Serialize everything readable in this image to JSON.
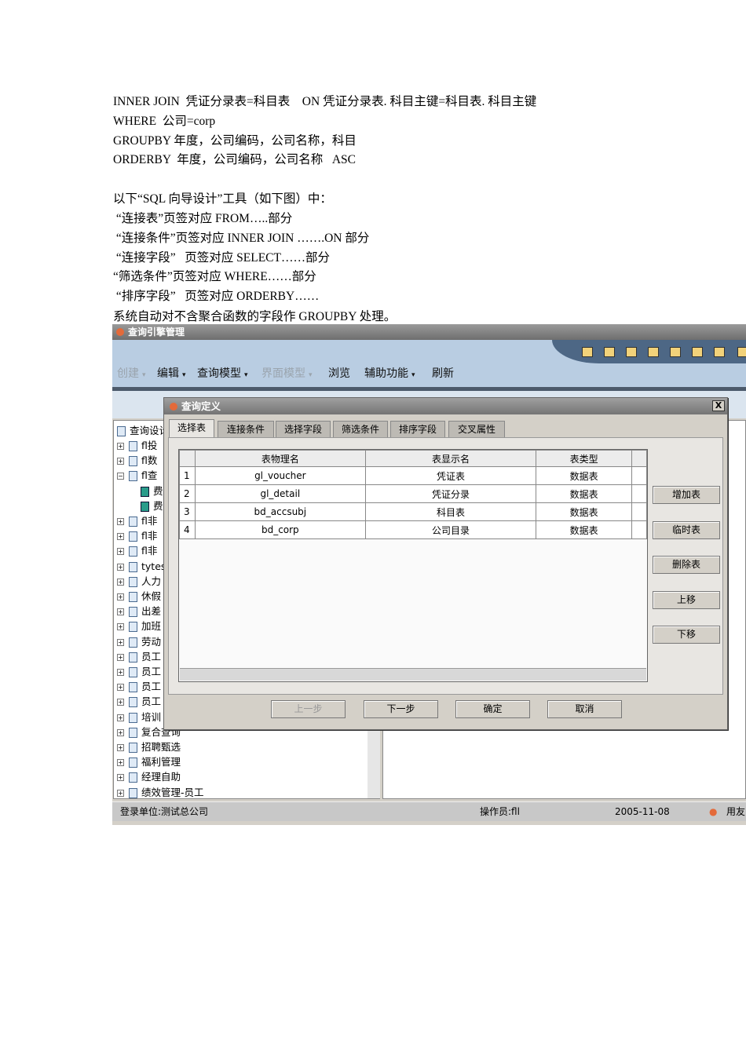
{
  "doc_lines": [
    "INNER JOIN  凭证分录表=科目表    ON 凭证分录表. 科目主键=科目表. 科目主键",
    "WHERE  公司=corp",
    "GROUPBY 年度，公司编码，公司名称，科目",
    "ORDERBY  年度，公司编码，公司名称   ASC",
    "以下“SQL 向导设计”工具（如下图）中：",
    " “连接表”页签对应 FROM…..部分",
    " “连接条件”页签对应 INNER JOIN …….ON 部分",
    " “连接字段”   页签对应 SELECT……部分",
    "“筛选条件”页签对应 WHERE……部分",
    " “排序字段”   页签对应 ORDERBY……",
    "系统自动对不含聚合函数的字段作 GROUPBY 处理。"
  ],
  "app": {
    "title": "查询引擎管理",
    "menu": [
      {
        "label": "创建",
        "disabled": true
      },
      {
        "label": "编辑"
      },
      {
        "label": "查询模型"
      },
      {
        "label": "界面模型",
        "disabled": true
      },
      {
        "label": "浏览"
      },
      {
        "label": "辅助功能"
      },
      {
        "label": "刷新"
      }
    ],
    "tree": {
      "root": "查询设计",
      "items": [
        "fl投",
        "fl数",
        "fl查",
        "费",
        "费",
        "fl非",
        "fl非",
        "fl非",
        "tytes",
        "人力",
        "休假",
        "出差",
        "加班",
        "劳动",
        "员工",
        "员工",
        "员工",
        "员工",
        "培训",
        "复合查询",
        "招聘甄选",
        "福利管理",
        "经理自助",
        "绩效管理-员工"
      ]
    },
    "status": {
      "unit": "登录单位:测试总公司",
      "operator": "操作员:fll",
      "date": "2005-11-08",
      "brand": "用友"
    }
  },
  "dialog": {
    "title": "查询定义",
    "close": "X",
    "tabs": [
      "选择表",
      "连接条件",
      "选择字段",
      "筛选条件",
      "排序字段",
      "交叉属性"
    ],
    "columns": [
      "表物理名",
      "表显示名",
      "表类型"
    ],
    "rows": [
      [
        "1",
        "gl_voucher",
        "凭证表",
        "数据表"
      ],
      [
        "2",
        "gl_detail",
        "凭证分录",
        "数据表"
      ],
      [
        "3",
        "bd_accsubj",
        "科目表",
        "数据表"
      ],
      [
        "4",
        "bd_corp",
        "公司目录",
        "数据表"
      ]
    ],
    "side_buttons": [
      "增加表",
      "临时表",
      "删除表",
      "上移",
      "下移"
    ],
    "bottom_buttons": [
      "上一步",
      "下一步",
      "确定",
      "取消"
    ]
  }
}
